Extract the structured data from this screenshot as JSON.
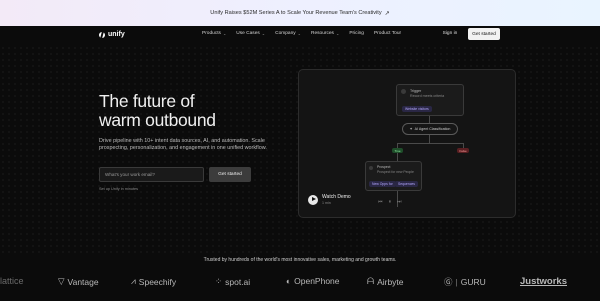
{
  "announcement": {
    "text": "Unify Raises $52M Series A to Scale Your Revenue Team's Creativity",
    "arrow": "↗"
  },
  "nav": {
    "brand": "unify",
    "menu": [
      {
        "label": "Products",
        "has_dropdown": true
      },
      {
        "label": "Use Cases",
        "has_dropdown": true
      },
      {
        "label": "Company",
        "has_dropdown": true
      },
      {
        "label": "Resources",
        "has_dropdown": true
      },
      {
        "label": "Pricing",
        "has_dropdown": false
      },
      {
        "label": "Product Tour",
        "has_dropdown": false
      }
    ],
    "signin": "Sign in",
    "get_started": "Get started"
  },
  "hero": {
    "title_line1": "The future of",
    "title_line2": "warm outbound",
    "subtitle": "Drive pipeline with 10+ intent data sources, AI, and automation. Scale prospecting, personalization, and engagement in one unified workflow.",
    "email_placeholder": "What's your work email?",
    "cta": "Get started",
    "note": "Set up Unify in minutes"
  },
  "workflow": {
    "trigger_title": "Trigger",
    "trigger_sub": "Record meets criteria",
    "trigger_chip": "Website visitors",
    "classify_label": "AI Agent Classification",
    "true_label": "True",
    "false_label": "False",
    "prospect_title": "Prospect",
    "prospect_sub": "Prospect for new People",
    "chip_a": "New Opps for",
    "chip_b": "Sequences",
    "video_title": "Watch Demo",
    "video_duration": "1 min",
    "controls": [
      "⏮",
      "⏸",
      "⏭"
    ]
  },
  "trusted": {
    "text": "Trusted by hundreds of the world's most innovative sales, marketing and growth teams."
  },
  "logos": [
    {
      "name": "lattice",
      "icon": ""
    },
    {
      "name": "Vantage",
      "icon": "vantage-icon"
    },
    {
      "name": "Speechify",
      "icon": "speechify-icon"
    },
    {
      "name": "spot.ai",
      "icon": "spot-icon"
    },
    {
      "name": "OpenPhone",
      "icon": "openphone-icon"
    },
    {
      "name": "Airbyte",
      "icon": "airbyte-icon"
    },
    {
      "name": "GURU",
      "icon": "guru-icon"
    },
    {
      "name": "Justworks",
      "icon": ""
    }
  ]
}
